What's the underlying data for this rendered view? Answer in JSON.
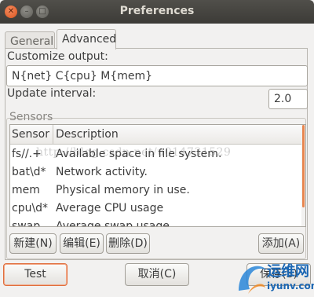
{
  "window": {
    "title": "Preferences"
  },
  "tabs": [
    {
      "label": "General",
      "selected": false
    },
    {
      "label": "Advanced",
      "selected": true
    }
  ],
  "advanced": {
    "customize_label": "Customize output:",
    "customize_value": "N{net}  C{cpu}  M{mem}",
    "update_label": "Update interval:",
    "update_value": "2.0"
  },
  "sensors": {
    "frame_label": "Sensors",
    "columns": [
      "Sensor",
      "Description"
    ],
    "rows": [
      {
        "sensor": "fs//.+",
        "description": "Available space in file system."
      },
      {
        "sensor": "bat\\d*",
        "description": "Network activity."
      },
      {
        "sensor": "mem",
        "description": "Physical memory in use."
      },
      {
        "sensor": "cpu\\d*",
        "description": "Average CPU usage"
      },
      {
        "sensor": "swap",
        "description": "Average swap usage"
      }
    ]
  },
  "buttons": {
    "new": "新建(N)",
    "edit": "编辑(E)",
    "delete": "删除(D)",
    "add": "添加(A)",
    "test": "Test",
    "cancel": "取消(C)",
    "save": "保存(S)"
  },
  "watermark": "http://blog.csdn.net/u014731529",
  "logo": {
    "text": "运维网",
    "url": "iyunv.com"
  },
  "colors": {
    "accent": "#e06e3c",
    "titlebar": "#3c3b37",
    "logo": "#1a66b3"
  }
}
